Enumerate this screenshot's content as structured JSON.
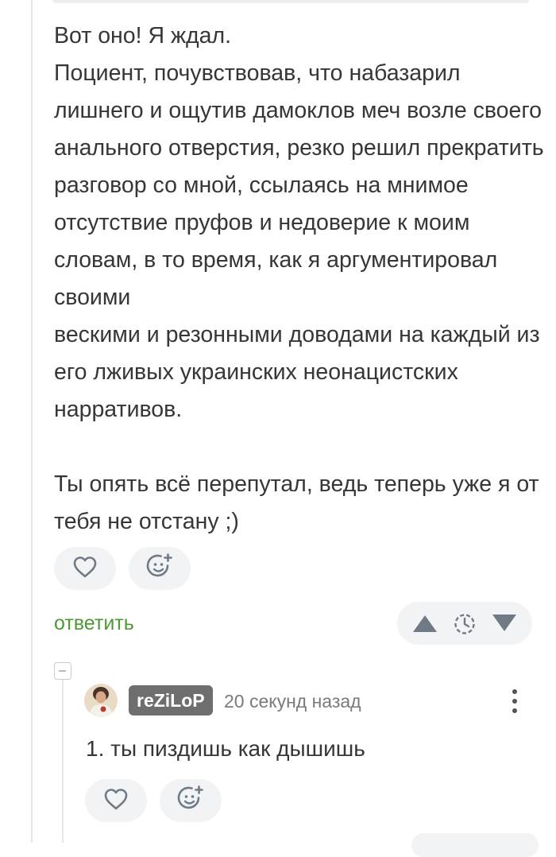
{
  "comment": {
    "text": "Вот оно! Я ждал.\nПоциент, почувствовав, что набазарил лишнего и ощутив дамоклов меч возле своего анального отверстия, резко решил прекратить разговор со мной, ссылаясь на мнимое отсутствие пруфов и недоверие к моим словам, в то время, как я аргументировал своими\nвескими и резонными доводами на каждый из его лживых украинских неонацистских нарративов.\n\nТы опять всё перепутал, ведь теперь уже я от тебя не отстану ;)",
    "reply_label": "ответить"
  },
  "reply": {
    "username": "reZiLoP",
    "time": "20 секунд назад",
    "text": "1. ты пиздишь как дышишь"
  },
  "icons": {
    "like": "heart-icon",
    "react": "smiley-add-icon",
    "upvote": "triangle-up-icon",
    "downvote": "triangle-down-icon",
    "pending": "clock-dashed-icon",
    "more": "kebab-menu-icon",
    "collapse": "collapse-minus-icon"
  },
  "colors": {
    "accent": "#4c9a33",
    "button_bg": "#f1f3f5",
    "username_bg": "#6e6e6e",
    "text": "#363636",
    "muted": "#7a7a7a",
    "icon": "#6f7a85"
  }
}
